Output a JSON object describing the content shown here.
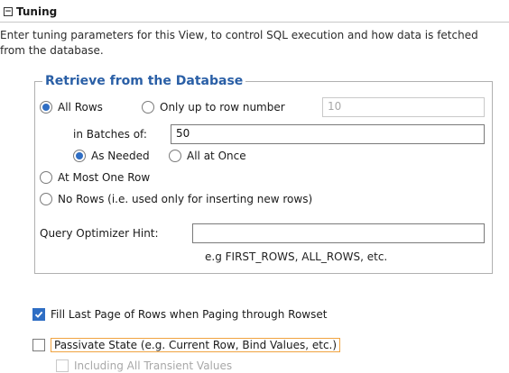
{
  "section": {
    "title": "Tuning",
    "description": "Enter tuning parameters for this View, to control SQL execution and how data is fetched from the database."
  },
  "retrieve": {
    "legend": "Retrieve from the Database",
    "all_rows_label": "All Rows",
    "only_up_to_label": "Only up to row number",
    "row_number_value": "10",
    "batches_label": "in Batches of:",
    "batches_value": "50",
    "as_needed_label": "As Needed",
    "all_at_once_label": "All at Once",
    "at_most_one_label": "At Most One Row",
    "no_rows_label": "No Rows (i.e. used only for inserting new rows)",
    "hint_label": "Query Optimizer Hint:",
    "hint_value": "",
    "hint_example": "e.g FIRST_ROWS, ALL_ROWS, etc."
  },
  "options": {
    "fill_last_page_label": "Fill Last Page of Rows when Paging through Rowset",
    "passivate_label": "Passivate State (e.g. Current Row, Bind Values, etc.)",
    "transient_label": "Including All Transient Values"
  },
  "colors": {
    "accent": "#2f6ec4",
    "legend": "#2a5fa6",
    "focus": "#f0a340"
  }
}
